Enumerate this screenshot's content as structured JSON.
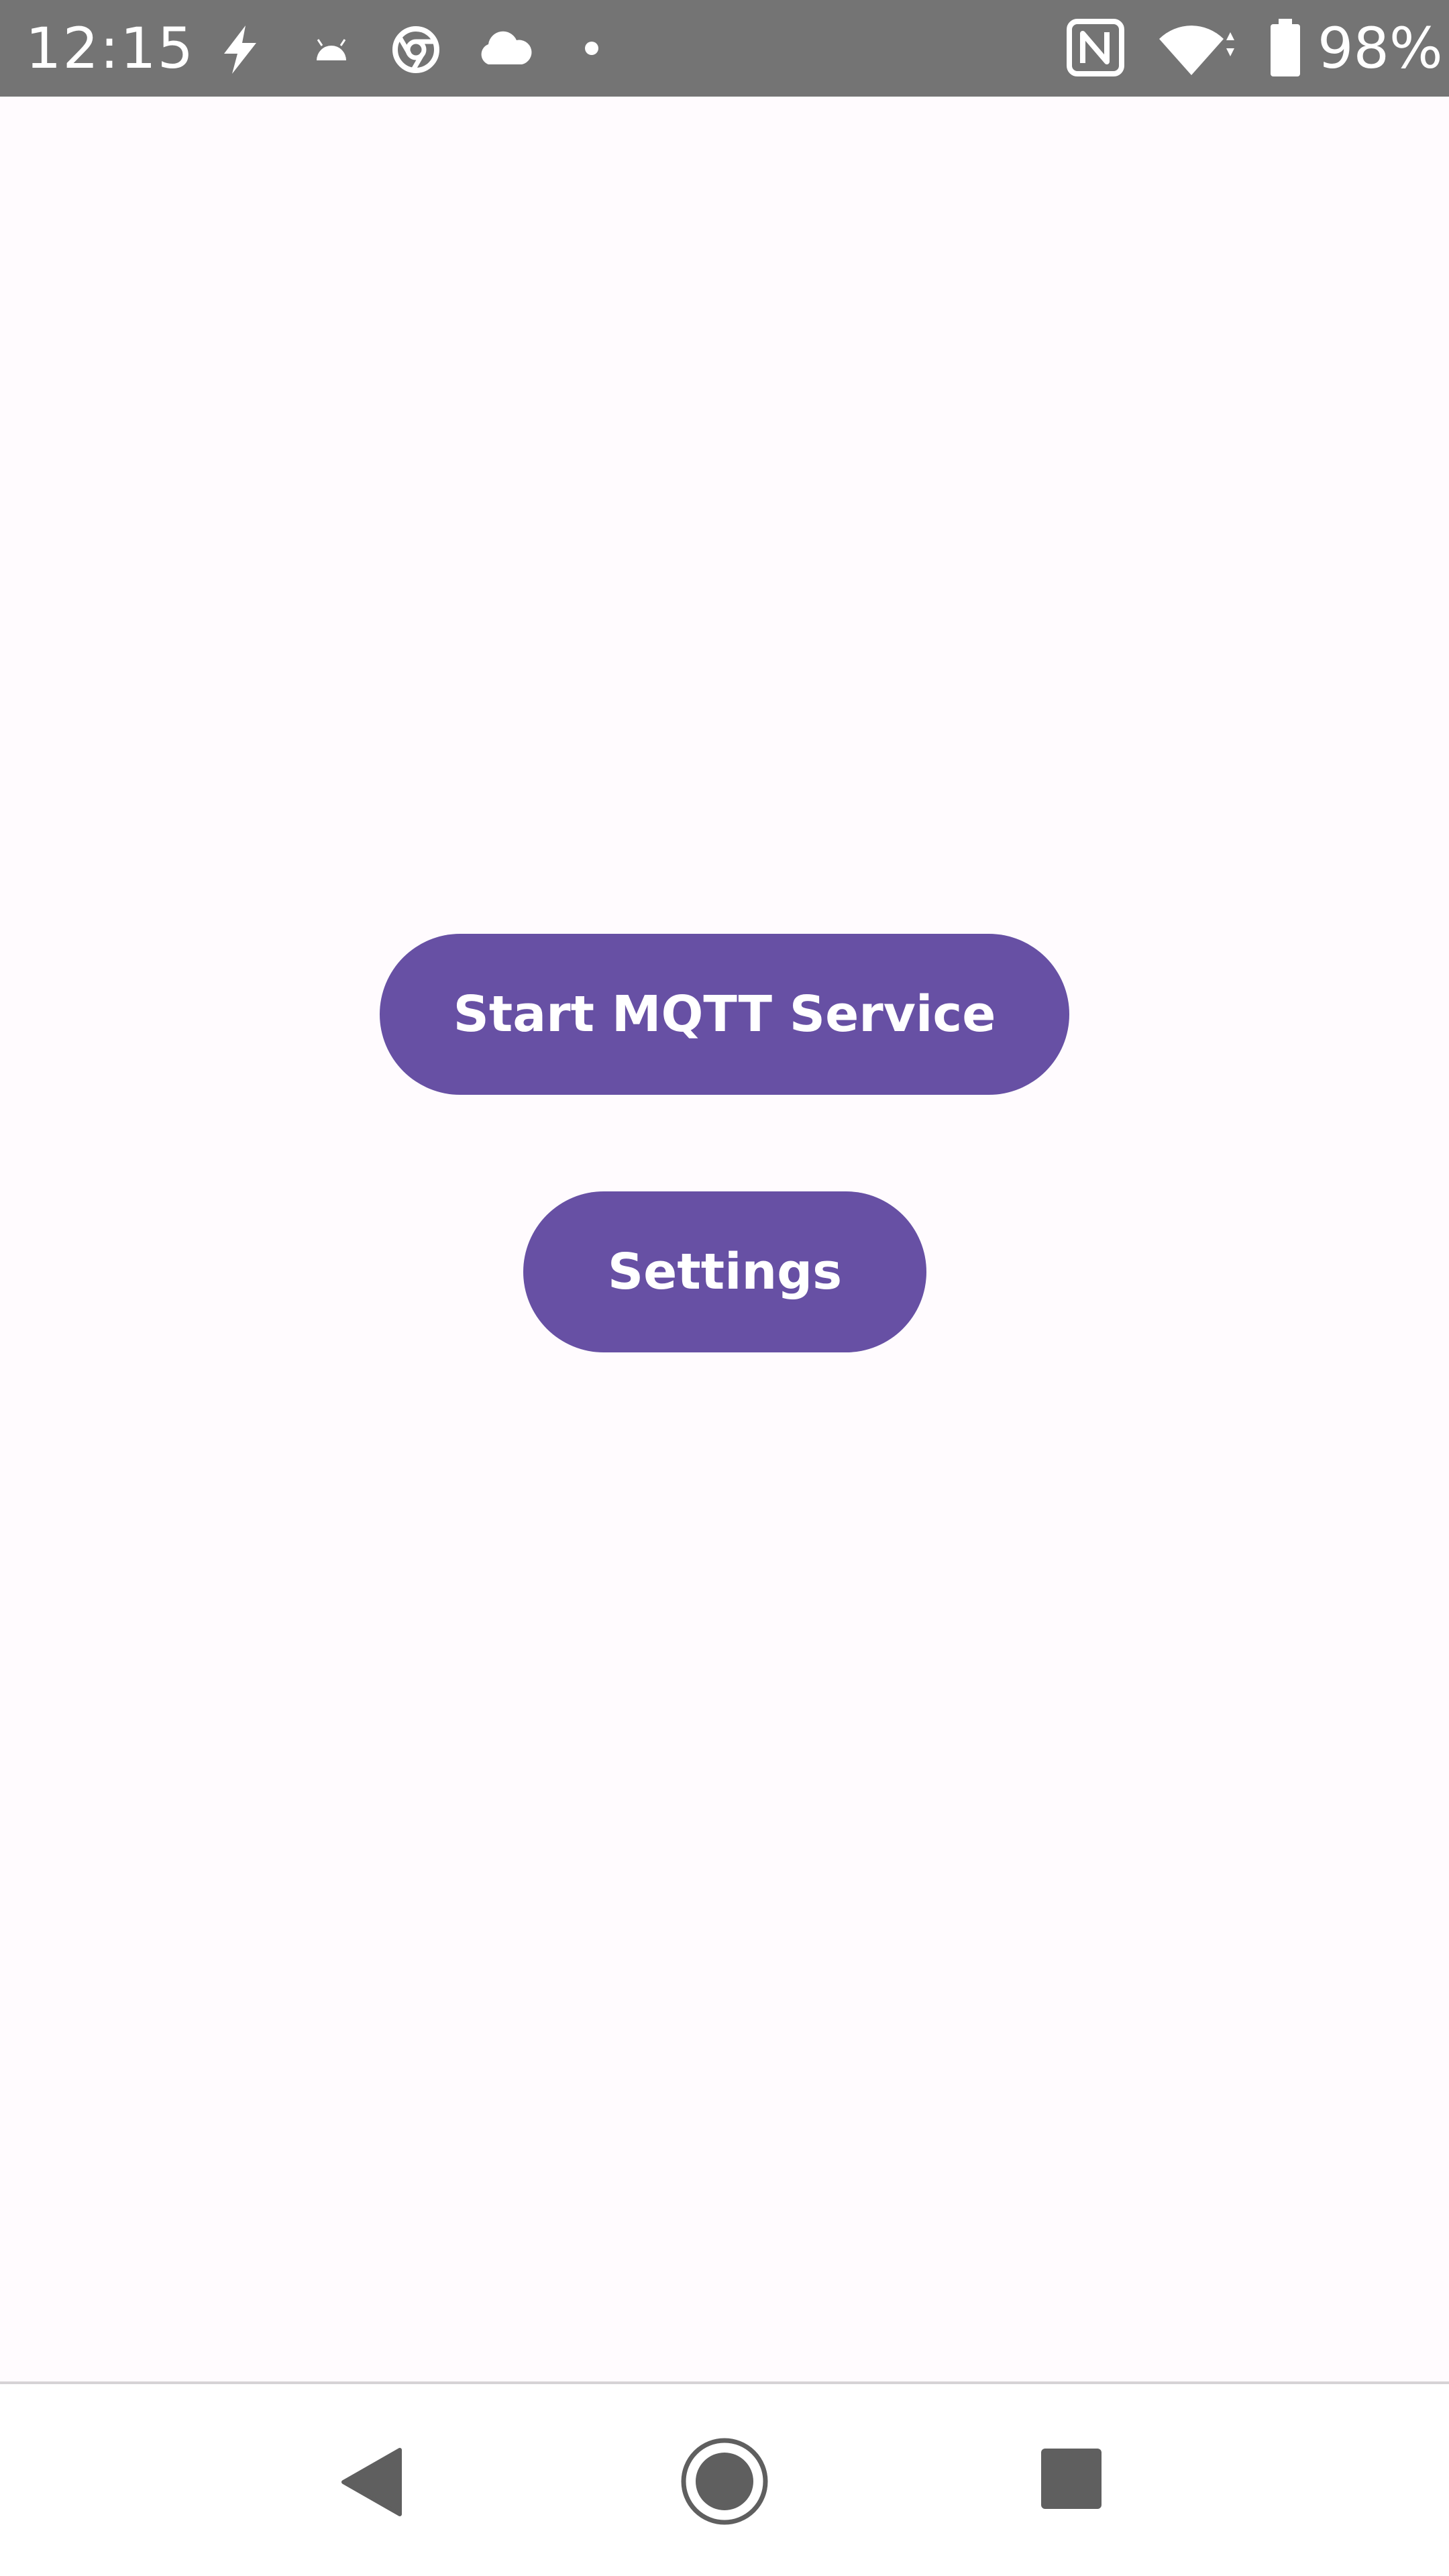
{
  "status_bar": {
    "time": "12:15",
    "battery_percent": "98%",
    "left_icons": [
      "bolt-icon",
      "android-icon",
      "chrome-icon",
      "cloud-icon",
      "dot-icon"
    ],
    "right_icons": [
      "nfc-icon",
      "wifi-icon",
      "battery-icon"
    ]
  },
  "main": {
    "start_button_label": "Start MQTT Service",
    "settings_button_label": "Settings"
  },
  "nav_bar": {
    "icons": [
      "back-icon",
      "home-icon",
      "recents-icon"
    ]
  },
  "colors": {
    "accent": "#6750A4",
    "status_bar": "#747474",
    "background": "#FFFBFE"
  }
}
